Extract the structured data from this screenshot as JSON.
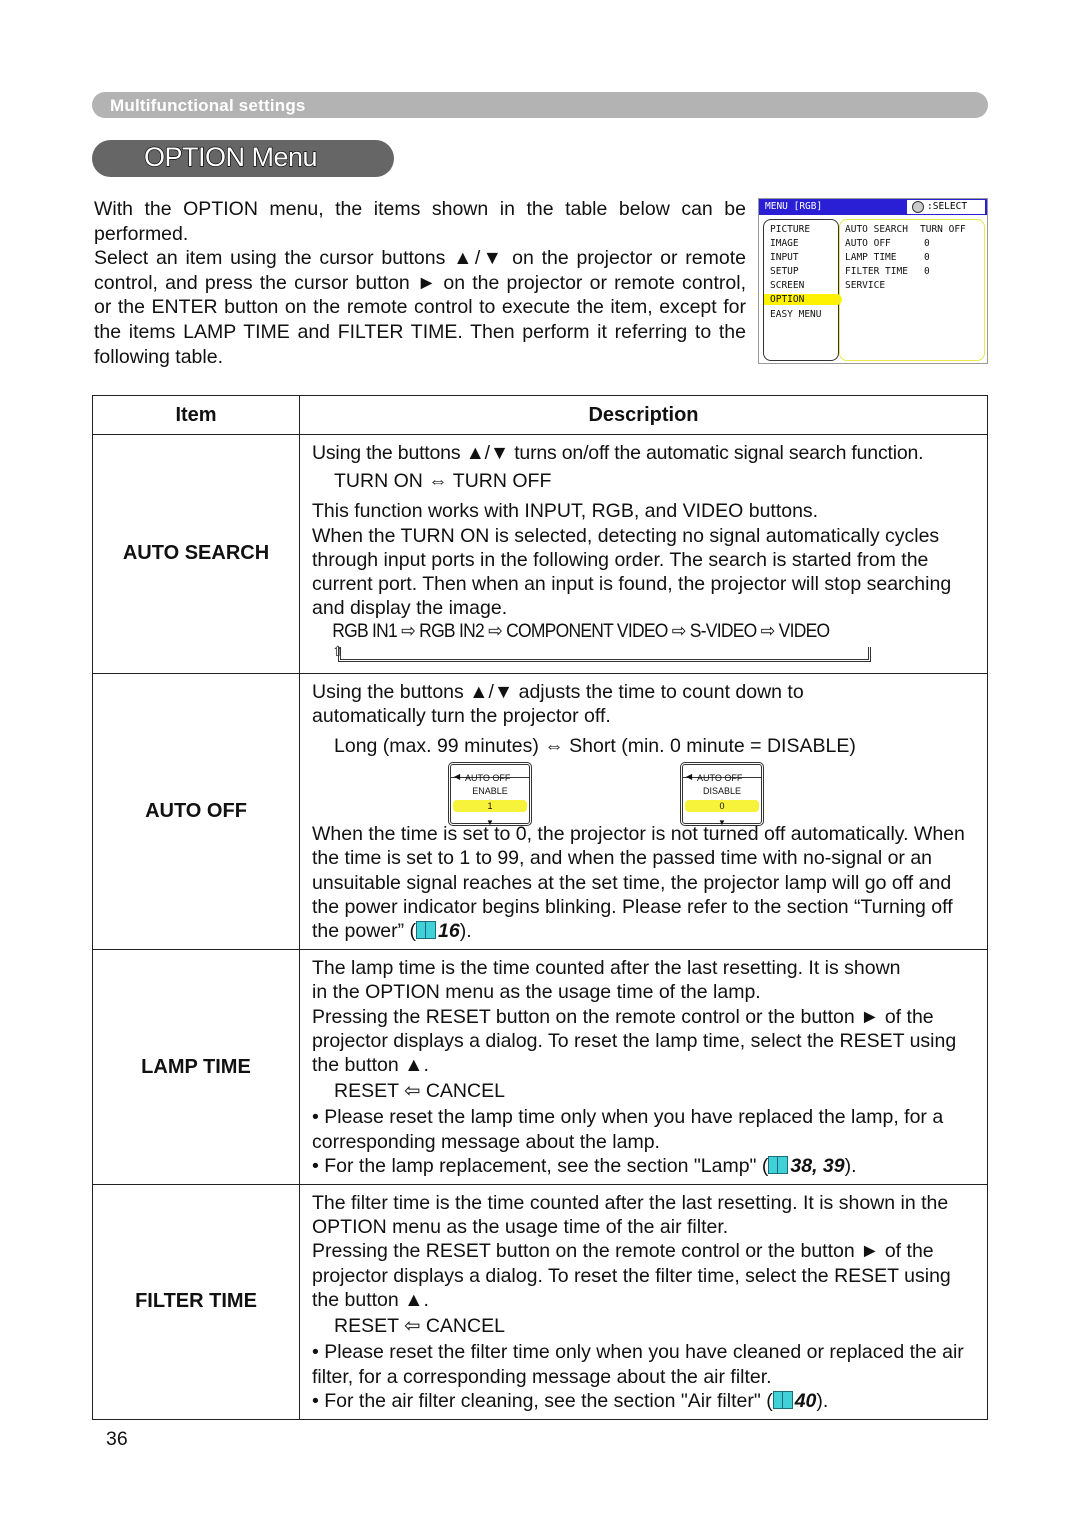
{
  "section_label": "Multifunctional settings",
  "title": "OPTION Menu",
  "intro": [
    "With the OPTION menu, the items shown in the table below can be performed.",
    "Select an item using the cursor buttons ▲/▼ on the projector or remote control, and press the cursor button ► on the projector or remote control, or the ENTER button on the remote control to execute the item, except for the items LAMP TIME and FILTER TIME. Then perform it referring to the following table."
  ],
  "osd": {
    "header": "MENU [RGB]",
    "select_label": ":SELECT",
    "left_items": [
      "PICTURE",
      "IMAGE",
      "INPUT",
      "SETUP",
      "SCREEN",
      "OPTION",
      "EASY MENU"
    ],
    "selected_index": 5,
    "right_items": [
      {
        "label": "AUTO SEARCH",
        "value": "TURN OFF"
      },
      {
        "label": "AUTO OFF",
        "value": "0"
      },
      {
        "label": "LAMP TIME",
        "value": "0"
      },
      {
        "label": "FILTER TIME",
        "value": "0"
      },
      {
        "label": "SERVICE",
        "value": ""
      }
    ],
    "highlight_color": "#fff200",
    "header_color": "#2b1fd6"
  },
  "table": {
    "headers": {
      "item": "Item",
      "description": "Description"
    },
    "auto_search": {
      "item": "AUTO SEARCH",
      "l1": "Using the buttons ▲/▼ turns on/off the automatic signal search function.",
      "l2": "TURN ON ⇔ TURN OFF",
      "l3": "This function works with INPUT, RGB, and VIDEO buttons.",
      "l4": "When the TURN ON is selected, detecting no signal automatically cycles through input ports in the following order. The search is started from the current port. Then when an input is found, the projector will stop searching and display the image.",
      "chain": "RGB IN1 ⇨ RGB IN2 ⇨ COMPONENT VIDEO ⇨ S-VIDEO ⇨ VIDEO"
    },
    "auto_off": {
      "item": "AUTO OFF",
      "l1": "Using the buttons ▲/▼ adjusts the time to count down to automatically turn the projector off.",
      "l2": "Long (max. 99 minutes) ⇔ Short (min. 0 minute = DISABLE)",
      "panel1": {
        "title": "AUTO OFF",
        "state": "ENABLE",
        "value": "1"
      },
      "panel2": {
        "title": "AUTO OFF",
        "state": "DISABLE",
        "value": "0"
      },
      "l3": "When the time is set to 0, the projector is not turned off automatically. When the time is set to 1 to 99, and when the passed time with no-signal or an unsuitable signal reaches at the set time, the projector lamp will go off and the power indicator begins blinking. Please refer to the section “Turning off the power” (",
      "ref": "16",
      "end": ")."
    },
    "lamp_time": {
      "item": "LAMP TIME",
      "l1": "The lamp time is the time counted after the last resetting. It is shown in the OPTION menu as the usage time of the lamp.",
      "l2": "Pressing the RESET button on the remote control or the button ► of the projector displays a dialog. To reset the lamp time, select the RESET using the button ▲.",
      "l3": "RESET ⇦ CANCEL",
      "l4": "• Please reset the lamp time only when you have replaced the lamp, for a corresponding message about the lamp.",
      "l5": "• For the lamp replacement, see the section \"Lamp\" (",
      "ref": "38, 39",
      "end": ")."
    },
    "filter_time": {
      "item": "FILTER TIME",
      "l1": "The filter time is the time counted after the last resetting. It is shown in the OPTION menu as the usage time of the air filter.",
      "l2": "Pressing the RESET button on the remote control or the button ► of the projector displays a dialog. To reset the filter time, select the RESET using the button ▲.",
      "l3": "RESET ⇦ CANCEL",
      "l4": "• Please reset the filter time only when you have cleaned or replaced the air filter, for a corresponding message about the air filter.",
      "l5": "• For the air filter cleaning, see the section \"Air filter\" (",
      "ref": "40",
      "end": ")."
    }
  },
  "page_number": "36"
}
